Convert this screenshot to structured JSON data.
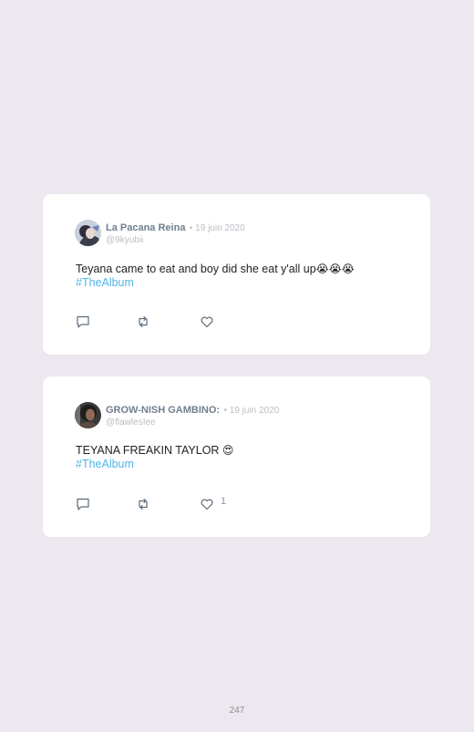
{
  "tweets": [
    {
      "author_name": "La Pacana Reina",
      "date": "• 19 juin 2020",
      "handle": "@9kyubii",
      "text": "Teyana came to eat and boy did she eat y'all up",
      "emoji": "😭😭😭",
      "hashtag": "#TheAlbum",
      "like_count": ""
    },
    {
      "author_name": "GROW-NISH GAMBINO:",
      "date": "• 19 juin 2020",
      "handle": "@flawlesIee",
      "text": "TEYANA FREAKIN TAYLOR ",
      "emoji": "😍",
      "hashtag": "#TheAlbum",
      "like_count": "1"
    }
  ],
  "icons": {
    "reply": "reply-icon",
    "retweet": "retweet-icon",
    "like": "heart-icon"
  },
  "colors": {
    "background": "#ede7ef",
    "card": "#ffffff",
    "name": "#6f7f8f",
    "muted": "#b9bec4",
    "hashtag": "#4fb6e6"
  },
  "page_number": "247"
}
